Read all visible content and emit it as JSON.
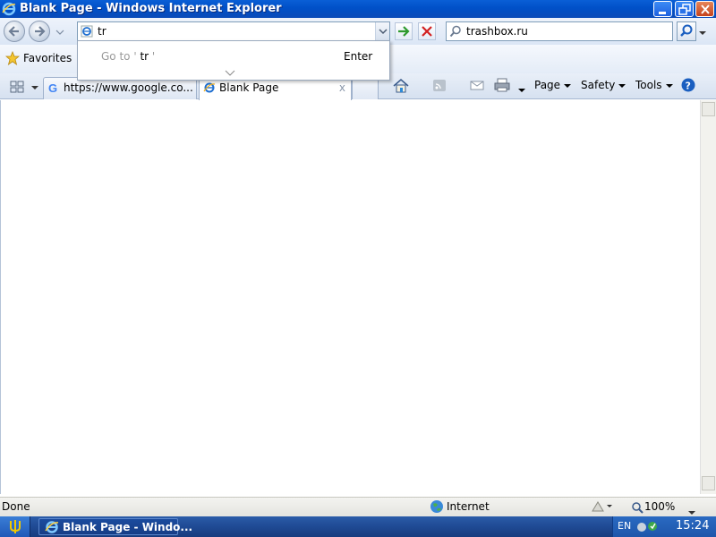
{
  "window": {
    "title": "Blank Page - Windows Internet Explorer",
    "controls": [
      "minimize",
      "restore",
      "close"
    ]
  },
  "navigation": {
    "back_icon": "back-arrow-icon",
    "forward_icon": "forward-arrow-icon",
    "address_value": "tr",
    "address_icon": "ie-page-icon",
    "search_value": "trashbox.ru",
    "search_icon": "search-icon"
  },
  "autocomplete": {
    "goto_prefix": "Go to '",
    "typed": "tr",
    "goto_suffix": "'",
    "enter_label": "Enter"
  },
  "favorites_bar": {
    "favorites_label": "Favorites"
  },
  "tabs": [
    {
      "label": "https://www.google.co...",
      "icon": "google-icon",
      "active": false
    },
    {
      "label": "Blank Page",
      "icon": "ie-page-icon",
      "active": true,
      "close_label": "x"
    }
  ],
  "command_bar": {
    "page_label": "Page",
    "safety_label": "Safety",
    "tools_label": "Tools",
    "icons": [
      "home-icon",
      "feeds-icon",
      "read-mail-icon",
      "print-icon",
      "help-icon"
    ]
  },
  "status_bar": {
    "status_text": "Done",
    "zone_label": "Internet",
    "zoom_label": "100%"
  },
  "taskbar": {
    "task_label": "Blank Page - Windo...",
    "language": "EN",
    "clock": "15:24"
  },
  "colors": {
    "titlebar": "#0050c8",
    "taskbar": "#1f4a94",
    "accent_green": "#2e9a2e",
    "accent_red": "#d22020"
  }
}
